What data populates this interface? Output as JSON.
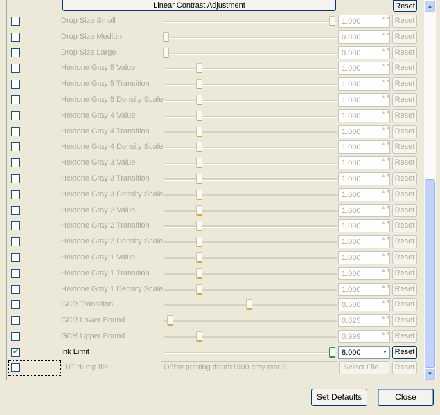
{
  "header": {
    "section_button": "Linear Contrast Adjustment",
    "reset_label": "Reset"
  },
  "rows": [
    {
      "label": "Drop Size Small",
      "value": "1.000",
      "slider_fraction": 1.0,
      "checked": false,
      "active": false
    },
    {
      "label": "Drop Size Medium",
      "value": "0.000",
      "slider_fraction": 0.0,
      "checked": false,
      "active": false
    },
    {
      "label": "Drop Size Large",
      "value": "0.000",
      "slider_fraction": 0.0,
      "checked": false,
      "active": false
    },
    {
      "label": "Hextone Gray 5 Value",
      "value": "1.000",
      "slider_fraction": 0.2,
      "checked": false,
      "active": false
    },
    {
      "label": "Hextone Gray 5 Transition",
      "value": "1.000",
      "slider_fraction": 0.2,
      "checked": false,
      "active": false
    },
    {
      "label": "Hextone Gray 5 Density Scale",
      "value": "1.000",
      "slider_fraction": 0.2,
      "checked": false,
      "active": false
    },
    {
      "label": "Hextone Gray 4 Value",
      "value": "1.000",
      "slider_fraction": 0.2,
      "checked": false,
      "active": false
    },
    {
      "label": "Hextone Gray 4 Transition",
      "value": "1.000",
      "slider_fraction": 0.2,
      "checked": false,
      "active": false
    },
    {
      "label": "Hextone Gray 4 Density Scale",
      "value": "1.000",
      "slider_fraction": 0.2,
      "checked": false,
      "active": false
    },
    {
      "label": "Hextone Gray 3 Value",
      "value": "1.000",
      "slider_fraction": 0.2,
      "checked": false,
      "active": false
    },
    {
      "label": "Hextone Gray 3 Transition",
      "value": "1.000",
      "slider_fraction": 0.2,
      "checked": false,
      "active": false
    },
    {
      "label": "Hextone Gray 3 Density Scale",
      "value": "1.000",
      "slider_fraction": 0.2,
      "checked": false,
      "active": false
    },
    {
      "label": "Hextone Gray 2 Value",
      "value": "1.000",
      "slider_fraction": 0.2,
      "checked": false,
      "active": false
    },
    {
      "label": "Hextone Gray 2 Transition",
      "value": "1.000",
      "slider_fraction": 0.2,
      "checked": false,
      "active": false
    },
    {
      "label": "Hextone Gray 2 Density Scale",
      "value": "1.000",
      "slider_fraction": 0.2,
      "checked": false,
      "active": false
    },
    {
      "label": "Hextone Gray 1 Value",
      "value": "1.000",
      "slider_fraction": 0.2,
      "checked": false,
      "active": false
    },
    {
      "label": "Hextone Gray 1 Transition",
      "value": "1.000",
      "slider_fraction": 0.2,
      "checked": false,
      "active": false
    },
    {
      "label": "Hextone Gray 1 Density Scale",
      "value": "1.000",
      "slider_fraction": 0.2,
      "checked": false,
      "active": false
    },
    {
      "label": "GCR Transition",
      "value": "0.500",
      "slider_fraction": 0.5,
      "checked": false,
      "active": false
    },
    {
      "label": "GCR Lower Bound",
      "value": "0.025",
      "slider_fraction": 0.025,
      "checked": false,
      "active": false
    },
    {
      "label": "GCR Upper Bound",
      "value": "0.999",
      "slider_fraction": 0.2,
      "checked": false,
      "active": false
    },
    {
      "label": "Ink Limit",
      "value": "8.000",
      "slider_fraction": 1.0,
      "checked": true,
      "active": true
    }
  ],
  "lut_row": {
    "label": "LUT dump file",
    "path": "O:\\bw printing data\\r1900 cmy test 3",
    "select_label": "Select File...",
    "reset_label": "Reset"
  },
  "footer": {
    "set_defaults": "Set Defaults",
    "close": "Close"
  },
  "colors": {
    "background": "#ece9d8",
    "disabled_text": "#aca899",
    "check_green": "#21a121",
    "slider_accent": "#e0a437",
    "scrollbar_blue": "#c1d3fb"
  }
}
